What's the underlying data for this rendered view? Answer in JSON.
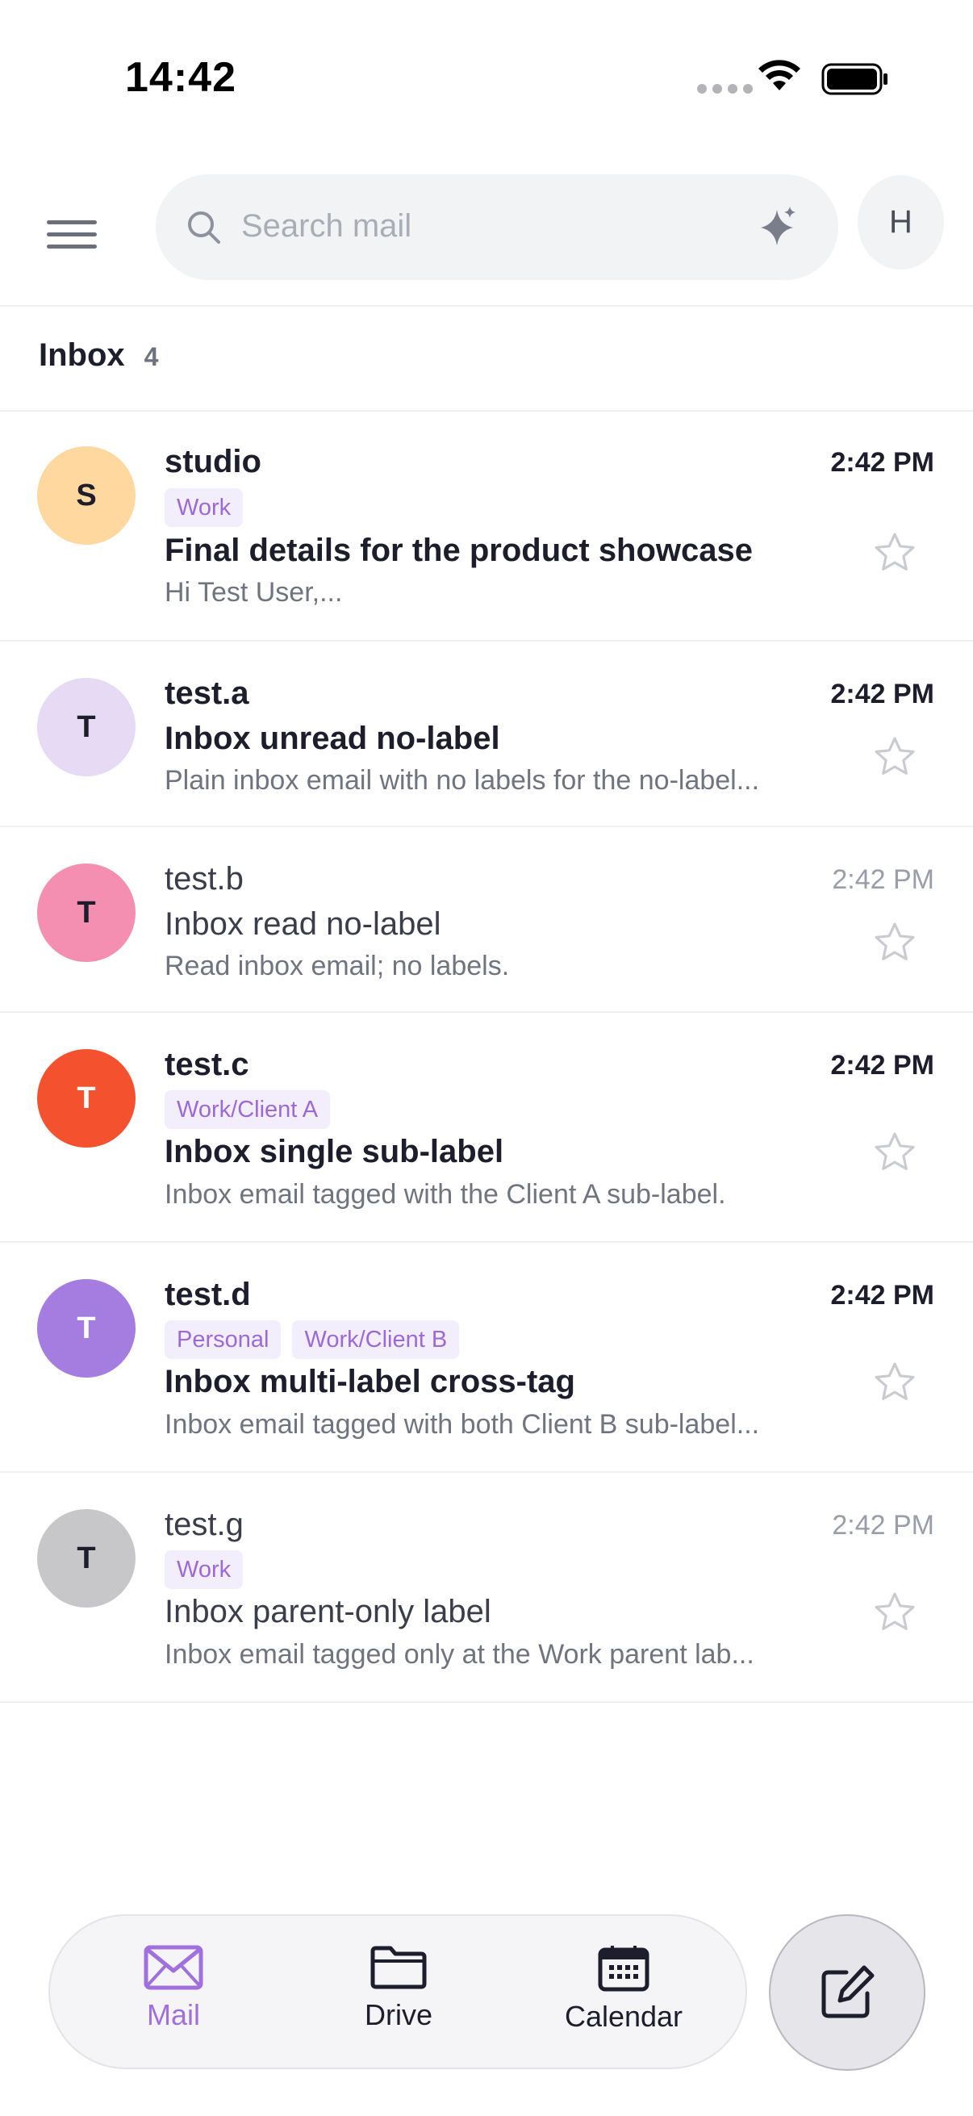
{
  "status_bar": {
    "time": "14:42"
  },
  "header": {
    "search_placeholder": "Search mail",
    "avatar_initial": "H"
  },
  "inbox": {
    "title": "Inbox",
    "count": "4"
  },
  "emails": [
    {
      "avatar_initial": "S",
      "avatar_color": "#ffd8a0",
      "sender": "studio",
      "time": "2:42 PM",
      "labels": [
        "Work"
      ],
      "subject": "Final details for the product showcase",
      "preview": "Hi Test User,...",
      "unread": true
    },
    {
      "avatar_initial": "T",
      "avatar_color": "#e6daf5",
      "sender": "test.a",
      "time": "2:42 PM",
      "labels": [],
      "subject": "Inbox unread no-label",
      "preview": "Plain inbox email with no labels for the no-label...",
      "unread": true
    },
    {
      "avatar_initial": "T",
      "avatar_color": "#f48fb1",
      "sender": "test.b",
      "time": "2:42 PM",
      "labels": [],
      "subject": "Inbox read no-label",
      "preview": "Read inbox email; no labels.",
      "unread": false
    },
    {
      "avatar_initial": "T",
      "avatar_color": "#f4512e",
      "sender": "test.c",
      "time": "2:42 PM",
      "labels": [
        "Work/Client A"
      ],
      "subject": "Inbox single sub-label",
      "preview": "Inbox email tagged with the Client A sub-label.",
      "unread": true
    },
    {
      "avatar_initial": "T",
      "avatar_color": "#a57ce0",
      "sender": "test.d",
      "time": "2:42 PM",
      "labels": [
        "Personal",
        "Work/Client B"
      ],
      "subject": "Inbox multi-label cross-tag",
      "preview": "Inbox email tagged with both Client B sub-label...",
      "unread": true
    },
    {
      "avatar_initial": "T",
      "avatar_color": "#c7c7c9",
      "sender": "test.g",
      "time": "2:42 PM",
      "labels": [
        "Work"
      ],
      "subject": "Inbox parent-only label",
      "preview": "Inbox email tagged only at the Work parent lab...",
      "unread": false
    }
  ],
  "bottom_nav": {
    "items": [
      {
        "label": "Mail",
        "icon": "mail-icon",
        "active": true
      },
      {
        "label": "Drive",
        "icon": "folder-icon",
        "active": false
      },
      {
        "label": "Calendar",
        "icon": "calendar-icon",
        "active": false
      }
    ],
    "compose_icon": "compose-icon"
  },
  "colors": {
    "accent": "#a071dc",
    "label_bg": "#f3eefb",
    "label_text": "#9c6ad8"
  }
}
